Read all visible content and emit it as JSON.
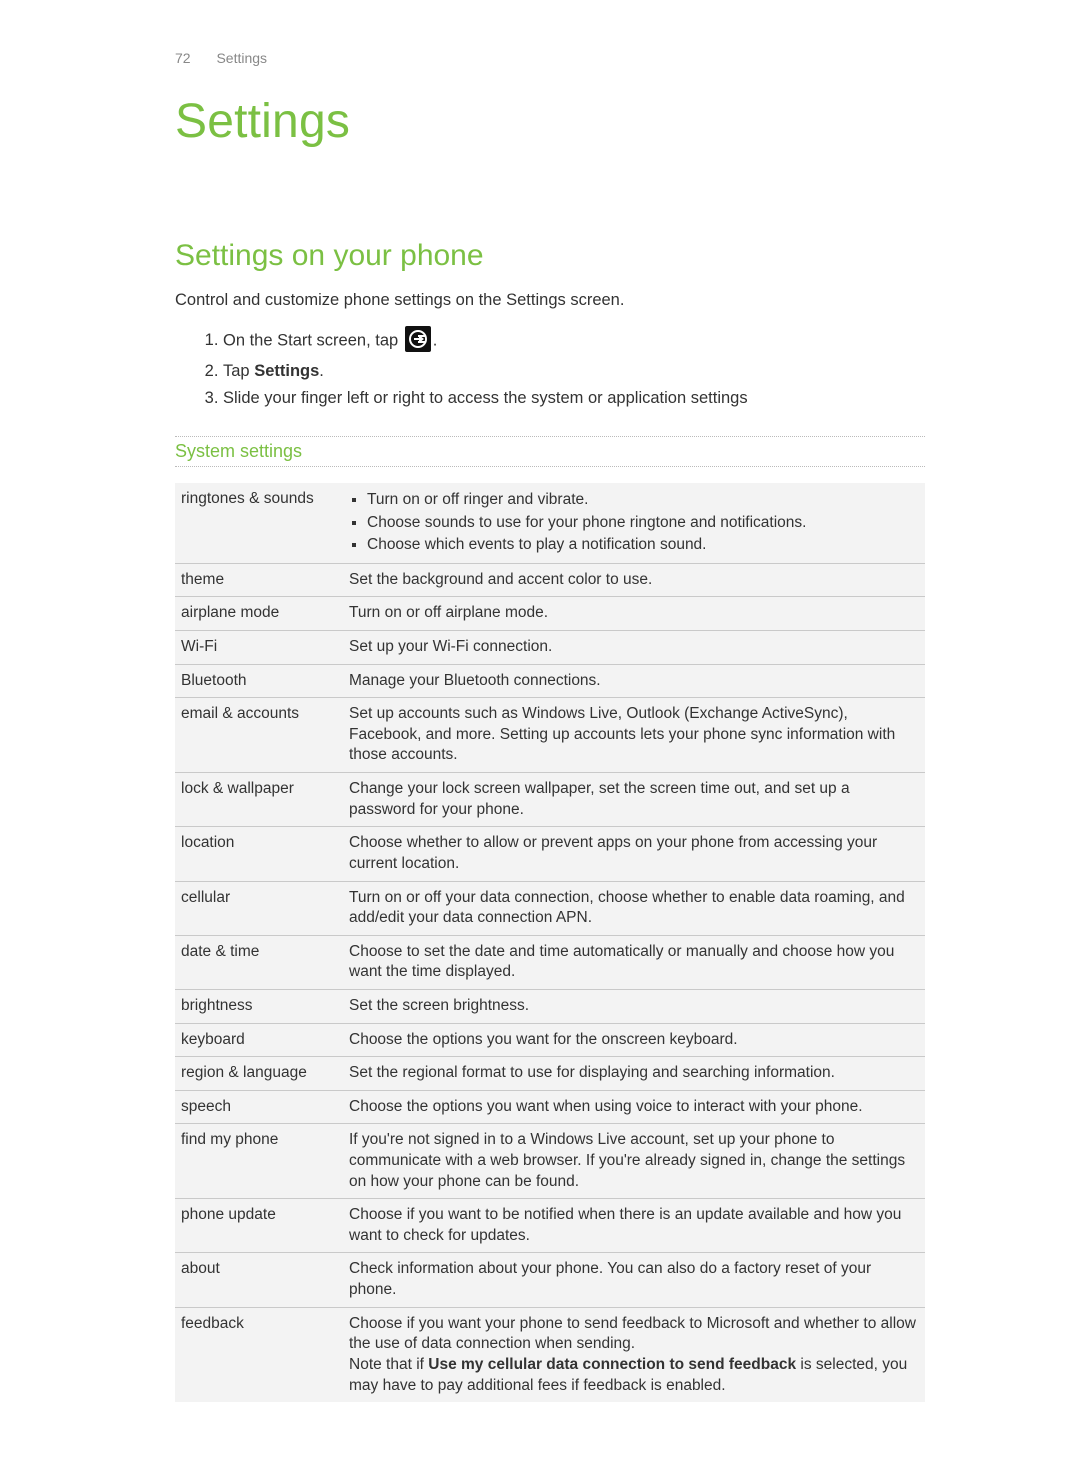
{
  "header": {
    "page_number": "72",
    "running_title": "Settings"
  },
  "chapter_title": "Settings",
  "section_title": "Settings on your phone",
  "lead": "Control and customize phone settings on the Settings screen.",
  "steps": {
    "s1_pre": "On the Start screen, tap ",
    "s1_post": ".",
    "s2_pre": "Tap ",
    "s2_bold": "Settings",
    "s2_post": ".",
    "s3": "Slide your finger left or right to access the system or application settings"
  },
  "subsection_title": "System settings",
  "icons": {
    "arrow_tile": "arrow-right-circle-icon"
  },
  "rows": {
    "ringtones": {
      "label": "ringtones & sounds",
      "b1": "Turn on or off ringer and vibrate.",
      "b2": "Choose sounds to use for your phone ringtone and notifications.",
      "b3": "Choose which events to play a notification sound."
    },
    "theme": {
      "label": "theme",
      "desc": "Set the background and accent color to use."
    },
    "airplane": {
      "label": "airplane mode",
      "desc": "Turn on or off airplane mode."
    },
    "wifi": {
      "label": "Wi-Fi",
      "desc": "Set up your Wi-Fi connection."
    },
    "bluetooth": {
      "label": "Bluetooth",
      "desc": "Manage your Bluetooth connections."
    },
    "email": {
      "label": "email & accounts",
      "desc": "Set up accounts such as Windows Live, Outlook (Exchange ActiveSync), Facebook, and more. Setting up accounts lets your phone sync information with those accounts."
    },
    "lock": {
      "label": "lock & wallpaper",
      "desc": "Change your lock screen wallpaper, set the screen time out, and set up a password for your phone."
    },
    "location": {
      "label": "location",
      "desc": "Choose whether to allow or prevent apps on your phone from accessing your current location."
    },
    "cellular": {
      "label": "cellular",
      "desc": "Turn on or off your data connection, choose whether to enable data roaming, and add/edit your data connection APN."
    },
    "datetime": {
      "label": "date & time",
      "desc": "Choose to set the date and time automatically or manually and choose how you want the time displayed."
    },
    "brightness": {
      "label": "brightness",
      "desc": "Set the screen brightness."
    },
    "keyboard": {
      "label": "keyboard",
      "desc": "Choose the options you want for the onscreen keyboard."
    },
    "region": {
      "label": "region & language",
      "desc": "Set the regional format to use for displaying and searching information."
    },
    "speech": {
      "label": "speech",
      "desc": "Choose the options you want when using voice to interact with your phone."
    },
    "findmyphone": {
      "label": "find my phone",
      "desc": "If you're not signed in to a Windows Live account, set up your phone to communicate with a web browser. If you're already signed in, change the settings on how your phone can be found."
    },
    "phoneupdate": {
      "label": "phone update",
      "desc": "Choose if you want to be notified when there is an update available and how you want to check for updates."
    },
    "about": {
      "label": "about",
      "desc": "Check information about your phone. You can also do a factory reset of your phone."
    },
    "feedback": {
      "label": "feedback",
      "p1": "Choose if you want your phone to send feedback to Microsoft and whether to allow the use of data connection when sending.",
      "p2_pre": "Note that if ",
      "p2_bold": "Use my cellular data connection to send feedback",
      "p2_post": " is selected, you may have to pay additional fees if feedback is enabled."
    }
  }
}
